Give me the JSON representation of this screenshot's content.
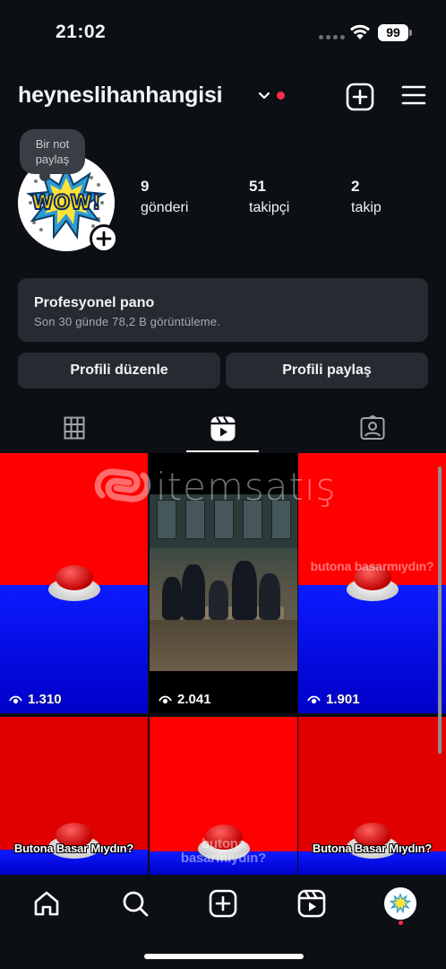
{
  "status_bar": {
    "time": "21:02",
    "battery": "99"
  },
  "header": {
    "username": "heyneslihanhangisi"
  },
  "note": {
    "text_line1": "Bir not",
    "text_line2": "paylaş"
  },
  "avatar": {
    "label": "WOW!"
  },
  "stats": [
    {
      "value": "9",
      "label": "gönderi"
    },
    {
      "value": "51",
      "label": "takipçi"
    },
    {
      "value": "2",
      "label": "takip"
    }
  ],
  "dashboard": {
    "title": "Profesyonel pano",
    "subtitle": "Son 30 günde 78,2 B görüntüleme."
  },
  "buttons": {
    "edit_profile": "Profili düzenle",
    "share_profile": "Profili paylaş"
  },
  "tabs": {
    "selected": "reels"
  },
  "reels": [
    {
      "views": "1.310"
    },
    {
      "views": "2.041"
    },
    {
      "views": "1.901",
      "caption": "butona basarmıydın?"
    },
    {
      "caption": "Butona Basar Mıydın?"
    },
    {
      "caption": "butona basarmıydın?"
    },
    {
      "caption": "Butona Basar Mıydın?"
    }
  ],
  "watermark": {
    "text": "itemsatış"
  },
  "colors": {
    "accent_red": "#ff2b4a",
    "reel_red": "#ff0000",
    "reel_blue": "#0c1bff"
  }
}
